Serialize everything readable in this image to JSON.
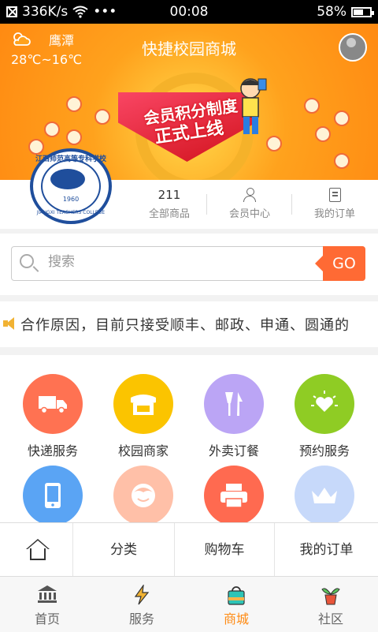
{
  "status_bar": {
    "network_speed": "336K/s",
    "more": "•••",
    "time": "00:08",
    "battery": "58%",
    "battery_level": 0.58
  },
  "header": {
    "city": "鹰潭",
    "temperature": "28℃~16℃",
    "title": "快捷校园商城"
  },
  "banner": {
    "line1": "会员积分制度",
    "line2": "正式上线"
  },
  "school_logo": {
    "top_text": "江西师范高等专科学校",
    "year": "1960",
    "bottom_text": "JIANGXI TEACHERS COLLEGE"
  },
  "stats": {
    "products_count": "211",
    "products_label": "全部商品",
    "member_label": "会员中心",
    "orders_label": "我的订单"
  },
  "search": {
    "placeholder": "搜索",
    "go_label": "GO"
  },
  "notice": {
    "text": "合作原因，目前只接受顺丰、邮政、申通、圆通的"
  },
  "services": [
    {
      "label": "快递服务",
      "color": "#ff7252",
      "icon": "truck-icon"
    },
    {
      "label": "校园商家",
      "color": "#fbc400",
      "icon": "shop-icon"
    },
    {
      "label": "外卖订餐",
      "color": "#bba5f5",
      "icon": "utensils-icon"
    },
    {
      "label": "预约服务",
      "color": "#8fcc24",
      "icon": "heart-sun-icon"
    },
    {
      "label": "",
      "color": "#5aa4f4",
      "icon": "phone-icon"
    },
    {
      "label": "",
      "color": "#ffc0a8",
      "icon": "smile-icon"
    },
    {
      "label": "",
      "color": "#ff6a50",
      "icon": "printer-icon"
    },
    {
      "label": "",
      "color": "#c7d9fa",
      "icon": "crown-icon"
    }
  ],
  "subnav": {
    "home_icon": "home-icon",
    "category": "分类",
    "cart": "购物车",
    "my_orders": "我的订单"
  },
  "tabbar": {
    "home": "首页",
    "service": "服务",
    "mall": "商城",
    "community": "社区",
    "active": "mall",
    "accent_color": "#ff8a12"
  }
}
